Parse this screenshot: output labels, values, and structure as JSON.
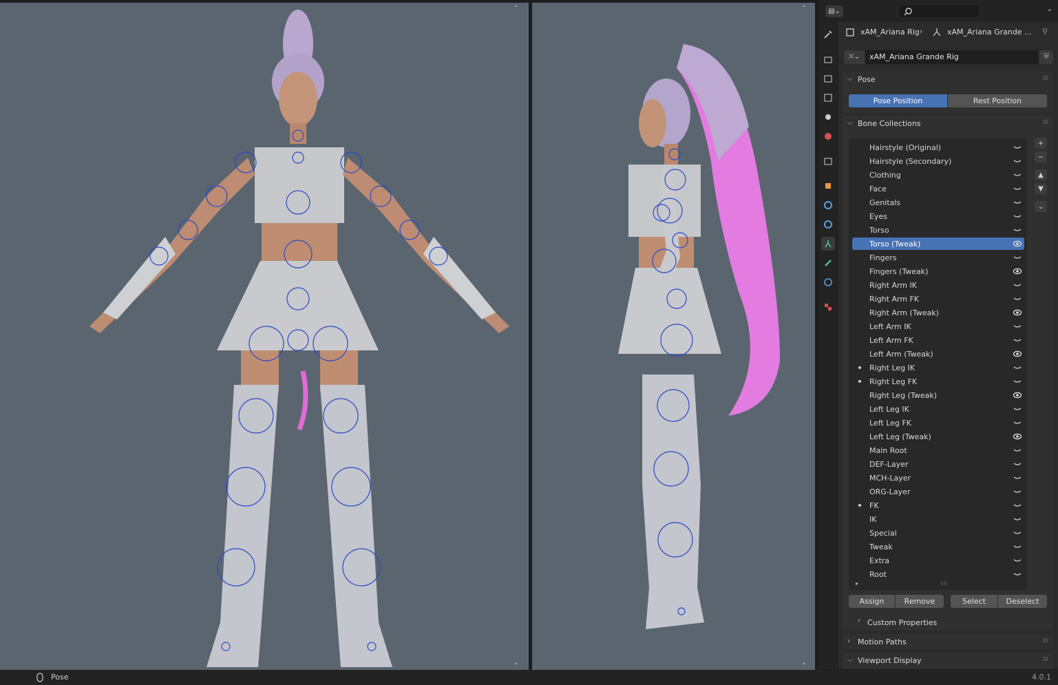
{
  "breadcrumb": {
    "object": "xAM_Ariana Rig",
    "data": "xAM_Ariana Grande ..."
  },
  "datablock": {
    "name": "xAM_Ariana Grande Rig"
  },
  "pose_panel": {
    "title": "Pose",
    "pose_position": "Pose Position",
    "rest_position": "Rest Position"
  },
  "bone_collections": {
    "title": "Bone Collections",
    "items": [
      {
        "label": "Hairstyle (Original)",
        "visible": false,
        "dot": false
      },
      {
        "label": "Hairstyle (Secondary)",
        "visible": false,
        "dot": false
      },
      {
        "label": "Clothing",
        "visible": false,
        "dot": false
      },
      {
        "label": "Face",
        "visible": false,
        "dot": false
      },
      {
        "label": "Genitals",
        "visible": false,
        "dot": false
      },
      {
        "label": "Eyes",
        "visible": false,
        "dot": false
      },
      {
        "label": "Torso",
        "visible": false,
        "dot": false
      },
      {
        "label": "Torso (Tweak)",
        "visible": true,
        "dot": false,
        "selected": true
      },
      {
        "label": "Fingers",
        "visible": false,
        "dot": false
      },
      {
        "label": "Fingers (Tweak)",
        "visible": true,
        "dot": false
      },
      {
        "label": "Right Arm IK",
        "visible": false,
        "dot": false
      },
      {
        "label": "Right Arm FK",
        "visible": false,
        "dot": false
      },
      {
        "label": "Right Arm (Tweak)",
        "visible": true,
        "dot": false
      },
      {
        "label": "Left Arm IK",
        "visible": false,
        "dot": false
      },
      {
        "label": "Left Arm FK",
        "visible": false,
        "dot": false
      },
      {
        "label": "Left Arm (Tweak)",
        "visible": true,
        "dot": false
      },
      {
        "label": "Right Leg IK",
        "visible": false,
        "dot": true
      },
      {
        "label": "Right Leg FK",
        "visible": false,
        "dot": true
      },
      {
        "label": "Right Leg (Tweak)",
        "visible": true,
        "dot": false
      },
      {
        "label": "Left Leg IK",
        "visible": false,
        "dot": false
      },
      {
        "label": "Left Leg FK",
        "visible": false,
        "dot": false
      },
      {
        "label": "Left Leg (Tweak)",
        "visible": true,
        "dot": false
      },
      {
        "label": "Main Root",
        "visible": false,
        "dot": false
      },
      {
        "label": "DEF-Layer",
        "visible": false,
        "dot": false
      },
      {
        "label": "MCH-Layer",
        "visible": false,
        "dot": false
      },
      {
        "label": "ORG-Layer",
        "visible": false,
        "dot": false
      },
      {
        "label": "FK",
        "visible": false,
        "dot": true
      },
      {
        "label": "IK",
        "visible": false,
        "dot": false
      },
      {
        "label": "Special",
        "visible": false,
        "dot": false
      },
      {
        "label": "Tweak",
        "visible": false,
        "dot": false
      },
      {
        "label": "Extra",
        "visible": false,
        "dot": false
      },
      {
        "label": "Root",
        "visible": false,
        "dot": false
      }
    ],
    "assign": "Assign",
    "remove": "Remove",
    "select": "Select",
    "deselect": "Deselect",
    "custom_properties": "Custom Properties"
  },
  "motion_paths": "Motion Paths",
  "viewport_display": "Viewport Display",
  "status": {
    "mode": "Pose",
    "version": "4.0.1"
  },
  "colors": {
    "accent": "#4772b3",
    "viewport": "#5a6570",
    "bone": "#2a48c8"
  }
}
